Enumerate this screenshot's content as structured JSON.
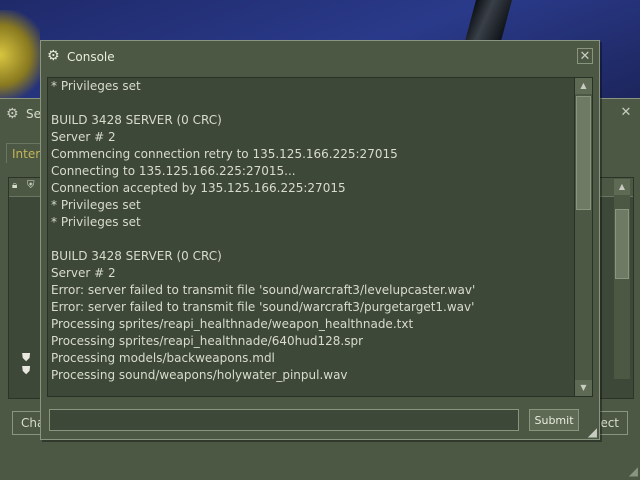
{
  "background_window": {
    "title": "Se",
    "tab_label": "Inter",
    "left_button_label": "Cha",
    "right_button_label": "ect",
    "icons": [
      "steam-icon",
      "close-icon",
      "lock-icon",
      "secure-icon",
      "shield-icon"
    ]
  },
  "console": {
    "title": "Console",
    "close_label": "✕",
    "icons": [
      "steam-icon",
      "close-icon",
      "scroll-up-arrow-icon",
      "scroll-down-arrow-icon",
      "resize-grip-icon"
    ],
    "lines": [
      "* Privileges set",
      "",
      "BUILD 3428 SERVER (0 CRC)",
      "Server # 2",
      "Commencing connection retry to 135.125.166.225:27015",
      "Connecting to 135.125.166.225:27015...",
      "Connection accepted by 135.125.166.225:27015",
      "* Privileges set",
      "* Privileges set",
      "",
      "BUILD 3428 SERVER (0 CRC)",
      "Server # 2",
      "Error: server failed to transmit file 'sound/warcraft3/levelupcaster.wav'",
      "Error: server failed to transmit file 'sound/warcraft3/purgetarget1.wav'",
      "Processing sprites/reapi_healthnade/weapon_healthnade.txt",
      "Processing sprites/reapi_healthnade/640hud128.spr",
      "Processing models/backweapons.mdl",
      "Processing sound/weapons/holywater_pinpul.wav"
    ],
    "input_value": "",
    "submit_label": "Submit"
  }
}
